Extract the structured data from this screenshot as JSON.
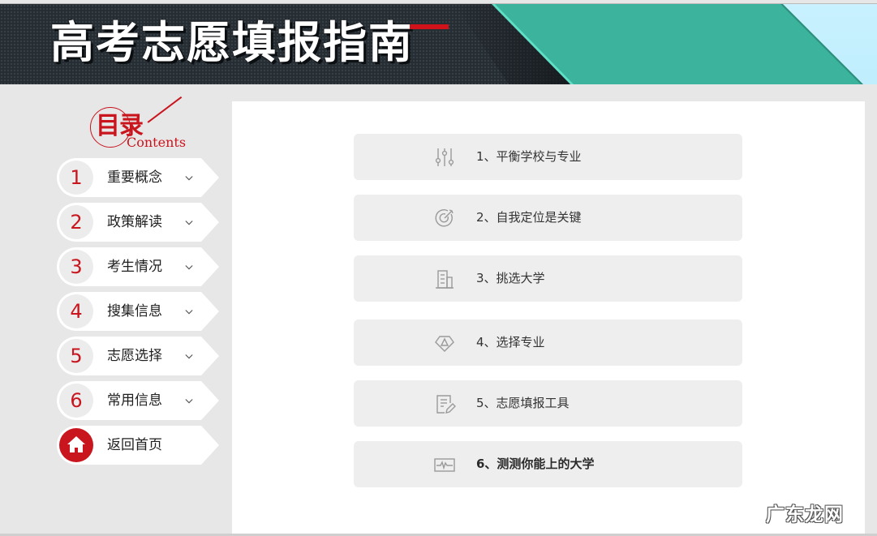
{
  "banner": {
    "title": "高考志愿填报指南",
    "colors": {
      "dark": "#262d33",
      "teal": "#3cb39c",
      "light": "#c9f1ff",
      "accent": "#d0121b"
    }
  },
  "toc": {
    "title": "目录",
    "subtitle": "Contents",
    "color": "#c9151e"
  },
  "sidebar": {
    "items": [
      {
        "num": "1",
        "label": "重要概念",
        "icon": "chevron-down-icon"
      },
      {
        "num": "2",
        "label": "政策解读",
        "icon": "chevron-down-icon"
      },
      {
        "num": "3",
        "label": "考生情况",
        "icon": "chevron-down-icon"
      },
      {
        "num": "4",
        "label": "搜集信息",
        "icon": "chevron-down-icon"
      },
      {
        "num": "5",
        "label": "志愿选择",
        "icon": "chevron-down-icon"
      },
      {
        "num": "6",
        "label": "常用信息",
        "icon": "chevron-down-icon"
      }
    ],
    "home": {
      "label": "返回首页",
      "icon": "home-icon"
    }
  },
  "main": {
    "cards": [
      {
        "label": "1、平衡学校与专业",
        "icon": "sliders-icon",
        "bold": false
      },
      {
        "label": "2、自我定位是关键",
        "icon": "target-icon",
        "bold": false
      },
      {
        "label": "3、挑选大学",
        "icon": "building-icon",
        "bold": false
      },
      {
        "label": "4、选择专业",
        "icon": "diamond-icon",
        "bold": false
      },
      {
        "label": "5、志愿填报工具",
        "icon": "document-edit-icon",
        "bold": false
      },
      {
        "label": "6、测测你能上的大学",
        "icon": "pulse-monitor-icon",
        "bold": true
      }
    ]
  },
  "watermark": "广东龙网"
}
